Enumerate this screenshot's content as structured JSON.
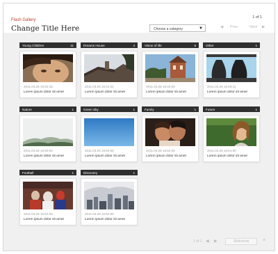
{
  "header": {
    "brand": "Flash Gallery",
    "title": "Change Title Here",
    "page_count": "1 of 1",
    "category_select": "Choose a category",
    "prev": "Prev",
    "next": "Next"
  },
  "cards": [
    {
      "category": "Young Children",
      "count": "11",
      "date": "2011.03.28 16:52:15",
      "caption": "Lorem ipsum dolor sit amet",
      "image": "child-face"
    },
    {
      "category": "Dreams House",
      "count": "4",
      "date": "2011.03.28 16:41:01",
      "caption": "Lorem ipsum dolor sit amet",
      "image": "house-roof"
    },
    {
      "category": "Vision of life",
      "count": "5",
      "date": "2011.03.28 16:44:50",
      "caption": "Lorem ipsum dolor sit amet",
      "image": "town-building"
    },
    {
      "category": "Other",
      "count": "1",
      "date": "2011.03.28 16:59:11",
      "caption": "Lorem ipsum dolor sit amet",
      "image": "bells"
    },
    {
      "category": "Nature",
      "count": "1",
      "date": "2011.03.28 16:50:53",
      "caption": "Lorem ipsum dolor sit amet",
      "image": "misty-mountains"
    },
    {
      "category": "Green Sky",
      "count": "1",
      "date": "2011.03.28 16:50:56",
      "caption": "Lorem ipsum dolor sit amet",
      "image": "blue-sky"
    },
    {
      "category": "Family",
      "count": "1",
      "date": "2011.03.28 16:52:00",
      "caption": "Lorem ipsum dolor sit amet",
      "image": "couple-kiss"
    },
    {
      "category": "Future",
      "count": "1",
      "date": "2011.03.28 16:51:50",
      "caption": "Lorem ipsum dolor sit amet",
      "image": "girl-field"
    },
    {
      "category": "Football",
      "count": "1",
      "date": "2011.03.28 16:52:03",
      "caption": "Lorem ipsum dolor sit amet",
      "image": "football-match"
    },
    {
      "category": "Discovery",
      "count": "1",
      "date": "2011.03.28 16:52:55",
      "caption": "Lorem ipsum dolor sit amet",
      "image": "city-skyline"
    }
  ],
  "footer": {
    "page_count": "1 of 1",
    "slideshow_button": "Slideshow",
    "close": "×"
  },
  "colors": {
    "brand": "#c0392b",
    "category_bar": "#2f2f2f",
    "background": "#f0f0f0"
  }
}
